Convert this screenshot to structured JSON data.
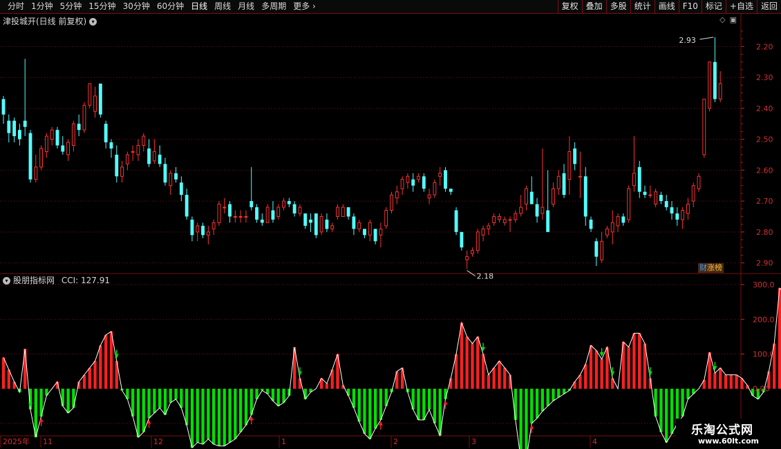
{
  "toolbar": {
    "periods": [
      "分时",
      "1分钟",
      "5分钟",
      "15分钟",
      "30分钟",
      "60分钟",
      "日线",
      "周线",
      "月线",
      "多周期",
      "更多"
    ],
    "active_period": "日线",
    "actions": [
      "复权",
      "叠加",
      "多股",
      "统计",
      "画线",
      "F10",
      "标记",
      "+自选",
      "返回"
    ]
  },
  "main_pane": {
    "title": "津投城开(日线 前复权)",
    "high_label": "2.93",
    "low_label": "2.18",
    "price_ticks": [
      "2.90",
      "2.80",
      "2.70",
      "2.60",
      "2.50",
      "2.40",
      "2.30",
      "2.20"
    ],
    "badge_part1": "财",
    "badge_part2": "涨榜"
  },
  "indicator_pane": {
    "title": "股朋指标网",
    "cci_label": "CCI: 127.91",
    "ticks": [
      "300.0",
      "200.0",
      "100.0",
      "0.00",
      "-100.0"
    ]
  },
  "date_axis": {
    "labels": [
      "2025年",
      "11",
      "12",
      "1",
      "2",
      "3",
      "4"
    ]
  },
  "watermark": {
    "line1": "乐淘公式网",
    "line2": "www.60lt.com"
  },
  "colors": {
    "up": "#ff3232",
    "down": "#54ffff",
    "cci_pos": "#ff2020",
    "cci_neg": "#00e000",
    "grid": "#7a1010"
  },
  "chart_data": [
    {
      "type": "candlestick",
      "title": "津投城开(日线 前复权)",
      "ylim": [
        2.17,
        2.97
      ],
      "y_ticks": [
        2.2,
        2.3,
        2.4,
        2.5,
        2.6,
        2.7,
        2.8,
        2.9
      ],
      "annotations": [
        {
          "text": "2.93",
          "value": 2.93
        },
        {
          "text": "2.18",
          "value": 2.18
        }
      ],
      "ohlc": [
        [
          2.73,
          2.74,
          2.65,
          2.68
        ],
        [
          2.66,
          2.68,
          2.59,
          2.62
        ],
        [
          2.66,
          2.67,
          2.59,
          2.61
        ],
        [
          2.63,
          2.65,
          2.58,
          2.6
        ],
        [
          2.66,
          2.86,
          2.61,
          2.64
        ],
        [
          2.62,
          2.63,
          2.46,
          2.47
        ],
        [
          2.47,
          2.55,
          2.46,
          2.51
        ],
        [
          2.51,
          2.58,
          2.5,
          2.57
        ],
        [
          2.56,
          2.62,
          2.54,
          2.61
        ],
        [
          2.6,
          2.64,
          2.58,
          2.63
        ],
        [
          2.63,
          2.64,
          2.57,
          2.58
        ],
        [
          2.58,
          2.61,
          2.55,
          2.56
        ],
        [
          2.55,
          2.6,
          2.53,
          2.59
        ],
        [
          2.58,
          2.66,
          2.56,
          2.65
        ],
        [
          2.65,
          2.68,
          2.61,
          2.63
        ],
        [
          2.63,
          2.72,
          2.62,
          2.71
        ],
        [
          2.71,
          2.78,
          2.7,
          2.78
        ],
        [
          2.69,
          2.77,
          2.67,
          2.74
        ],
        [
          2.78,
          2.78,
          2.67,
          2.68
        ],
        [
          2.65,
          2.66,
          2.57,
          2.59
        ],
        [
          2.59,
          2.6,
          2.54,
          2.57
        ],
        [
          2.55,
          2.58,
          2.46,
          2.48
        ],
        [
          2.48,
          2.53,
          2.46,
          2.51
        ],
        [
          2.52,
          2.56,
          2.5,
          2.55
        ],
        [
          2.56,
          2.58,
          2.53,
          2.56
        ],
        [
          2.55,
          2.6,
          2.53,
          2.58
        ],
        [
          2.58,
          2.62,
          2.56,
          2.61
        ],
        [
          2.57,
          2.6,
          2.51,
          2.52
        ],
        [
          2.53,
          2.6,
          2.52,
          2.56
        ],
        [
          2.55,
          2.58,
          2.51,
          2.52
        ],
        [
          2.52,
          2.54,
          2.45,
          2.46
        ],
        [
          2.45,
          2.5,
          2.42,
          2.49
        ],
        [
          2.49,
          2.51,
          2.46,
          2.47
        ],
        [
          2.46,
          2.48,
          2.4,
          2.42
        ],
        [
          2.42,
          2.44,
          2.34,
          2.35
        ],
        [
          2.34,
          2.35,
          2.27,
          2.29
        ],
        [
          2.3,
          2.33,
          2.27,
          2.32
        ],
        [
          2.32,
          2.33,
          2.28,
          2.29
        ],
        [
          2.29,
          2.32,
          2.26,
          2.3
        ],
        [
          2.31,
          2.34,
          2.29,
          2.33
        ],
        [
          2.33,
          2.4,
          2.32,
          2.39
        ],
        [
          2.38,
          2.41,
          2.36,
          2.38
        ],
        [
          2.39,
          2.4,
          2.33,
          2.35
        ],
        [
          2.35,
          2.37,
          2.33,
          2.35
        ],
        [
          2.35,
          2.37,
          2.33,
          2.35
        ],
        [
          2.35,
          2.37,
          2.33,
          2.35
        ],
        [
          2.4,
          2.51,
          2.37,
          2.38
        ],
        [
          2.38,
          2.39,
          2.33,
          2.34
        ],
        [
          2.34,
          2.36,
          2.32,
          2.33
        ],
        [
          2.33,
          2.39,
          2.33,
          2.38
        ],
        [
          2.37,
          2.4,
          2.33,
          2.34
        ],
        [
          2.35,
          2.39,
          2.34,
          2.38
        ],
        [
          2.38,
          2.41,
          2.37,
          2.4
        ],
        [
          2.4,
          2.41,
          2.38,
          2.39
        ],
        [
          2.39,
          2.4,
          2.35,
          2.36
        ],
        [
          2.36,
          2.39,
          2.35,
          2.38
        ],
        [
          2.36,
          2.36,
          2.31,
          2.32
        ],
        [
          2.34,
          2.36,
          2.3,
          2.33
        ],
        [
          2.36,
          2.36,
          2.28,
          2.29
        ],
        [
          2.3,
          2.36,
          2.29,
          2.35
        ],
        [
          2.34,
          2.36,
          2.3,
          2.31
        ],
        [
          2.31,
          2.33,
          2.3,
          2.32
        ],
        [
          2.35,
          2.39,
          2.34,
          2.38
        ],
        [
          2.35,
          2.39,
          2.35,
          2.38
        ],
        [
          2.38,
          2.38,
          2.34,
          2.35
        ],
        [
          2.35,
          2.36,
          2.29,
          2.31
        ],
        [
          2.31,
          2.34,
          2.3,
          2.33
        ],
        [
          2.31,
          2.31,
          2.28,
          2.29
        ],
        [
          2.29,
          2.34,
          2.27,
          2.33
        ],
        [
          2.31,
          2.31,
          2.26,
          2.27
        ],
        [
          2.29,
          2.33,
          2.25,
          2.31
        ],
        [
          2.32,
          2.38,
          2.31,
          2.37
        ],
        [
          2.37,
          2.43,
          2.36,
          2.42
        ],
        [
          2.41,
          2.45,
          2.39,
          2.43
        ],
        [
          2.44,
          2.48,
          2.42,
          2.47
        ],
        [
          2.46,
          2.49,
          2.44,
          2.48
        ],
        [
          2.47,
          2.49,
          2.43,
          2.45
        ],
        [
          2.47,
          2.49,
          2.46,
          2.48
        ],
        [
          2.48,
          2.49,
          2.43,
          2.44
        ],
        [
          2.41,
          2.44,
          2.39,
          2.42
        ],
        [
          2.42,
          2.47,
          2.41,
          2.46
        ],
        [
          2.48,
          2.51,
          2.45,
          2.49
        ],
        [
          2.5,
          2.51,
          2.43,
          2.44
        ],
        [
          2.44,
          2.44,
          2.42,
          2.43
        ],
        [
          2.37,
          2.38,
          2.29,
          2.3
        ],
        [
          2.3,
          2.3,
          2.24,
          2.25
        ],
        [
          2.21,
          2.24,
          2.18,
          2.22
        ],
        [
          2.23,
          2.25,
          2.22,
          2.24
        ],
        [
          2.24,
          2.31,
          2.23,
          2.3
        ],
        [
          2.29,
          2.32,
          2.27,
          2.31
        ],
        [
          2.31,
          2.33,
          2.29,
          2.32
        ],
        [
          2.33,
          2.36,
          2.32,
          2.35
        ],
        [
          2.34,
          2.36,
          2.33,
          2.35
        ],
        [
          2.33,
          2.35,
          2.32,
          2.34
        ],
        [
          2.34,
          2.35,
          2.3,
          2.34
        ],
        [
          2.34,
          2.37,
          2.33,
          2.36
        ],
        [
          2.36,
          2.42,
          2.35,
          2.38
        ],
        [
          2.39,
          2.45,
          2.37,
          2.44
        ],
        [
          2.43,
          2.48,
          2.39,
          2.39
        ],
        [
          2.39,
          2.41,
          2.33,
          2.35
        ],
        [
          2.36,
          2.57,
          2.34,
          2.38
        ],
        [
          2.37,
          2.5,
          2.3,
          2.3
        ],
        [
          2.39,
          2.46,
          2.38,
          2.44
        ],
        [
          2.44,
          2.5,
          2.42,
          2.48
        ],
        [
          2.49,
          2.52,
          2.41,
          2.42
        ],
        [
          2.47,
          2.61,
          2.42,
          2.56
        ],
        [
          2.57,
          2.59,
          2.5,
          2.52
        ],
        [
          2.48,
          2.56,
          2.41,
          2.48
        ],
        [
          2.48,
          2.51,
          2.32,
          2.35
        ],
        [
          2.34,
          2.35,
          2.3,
          2.31
        ],
        [
          2.27,
          2.28,
          2.19,
          2.22
        ],
        [
          2.21,
          2.3,
          2.2,
          2.27
        ],
        [
          2.29,
          2.32,
          2.28,
          2.31
        ],
        [
          2.3,
          2.37,
          2.26,
          2.33
        ],
        [
          2.32,
          2.36,
          2.3,
          2.35
        ],
        [
          2.35,
          2.36,
          2.32,
          2.33
        ],
        [
          2.34,
          2.45,
          2.33,
          2.44
        ],
        [
          2.45,
          2.61,
          2.43,
          2.49
        ],
        [
          2.51,
          2.53,
          2.41,
          2.43
        ],
        [
          2.43,
          2.45,
          2.41,
          2.42
        ],
        [
          2.42,
          2.45,
          2.41,
          2.42
        ],
        [
          2.39,
          2.44,
          2.38,
          2.43
        ],
        [
          2.42,
          2.43,
          2.39,
          2.4
        ],
        [
          2.4,
          2.42,
          2.37,
          2.38
        ],
        [
          2.38,
          2.4,
          2.34,
          2.36
        ],
        [
          2.36,
          2.38,
          2.32,
          2.34
        ],
        [
          2.34,
          2.38,
          2.31,
          2.37
        ],
        [
          2.36,
          2.41,
          2.34,
          2.39
        ],
        [
          2.4,
          2.46,
          2.38,
          2.45
        ],
        [
          2.44,
          2.49,
          2.43,
          2.48
        ],
        [
          2.55,
          2.73,
          2.54,
          2.73
        ],
        [
          2.7,
          2.85,
          2.69,
          2.85
        ],
        [
          2.85,
          2.93,
          2.72,
          2.73
        ],
        [
          2.73,
          2.82,
          2.72,
          2.78
        ]
      ]
    },
    {
      "type": "bar",
      "title": "股朋指标网",
      "series": [
        {
          "name": "CCI",
          "last": 127.91
        }
      ],
      "ylim": [
        -130,
        320
      ],
      "y_ticks": [
        300,
        200,
        100,
        0,
        -100
      ],
      "values": [
        90,
        55,
        20,
        -10,
        115,
        -60,
        -140,
        -80,
        -20,
        0,
        20,
        -50,
        -70,
        -55,
        20,
        40,
        60,
        80,
        125,
        155,
        165,
        80,
        -5,
        -30,
        -80,
        -140,
        -125,
        -85,
        -70,
        -55,
        -75,
        -40,
        -30,
        -55,
        -105,
        -170,
        -155,
        -160,
        -145,
        -160,
        -165,
        -165,
        -155,
        -145,
        -125,
        -105,
        -75,
        -30,
        -5,
        -15,
        -35,
        -50,
        -40,
        -20,
        120,
        30,
        -30,
        -10,
        0,
        30,
        15,
        55,
        100,
        10,
        -20,
        -55,
        -95,
        -130,
        -145,
        -115,
        -90,
        -50,
        -10,
        50,
        60,
        -10,
        -60,
        -90,
        -90,
        -60,
        -100,
        -135,
        -30,
        30,
        100,
        190,
        150,
        130,
        150,
        100,
        40,
        60,
        80,
        60,
        40,
        -90,
        -205,
        -205,
        -100,
        -85,
        -65,
        -50,
        -35,
        -25,
        -15,
        -5,
        20,
        40,
        70,
        125,
        110,
        85,
        120,
        30,
        0,
        135,
        120,
        160,
        160,
        130,
        30,
        -80,
        -125,
        -155,
        -130,
        -100,
        -80,
        -30,
        -15,
        0,
        25,
        105,
        45,
        60,
        40,
        40,
        40,
        30,
        10,
        -20,
        -30,
        -10,
        50,
        130,
        290,
        275,
        170,
        128
      ]
    }
  ]
}
